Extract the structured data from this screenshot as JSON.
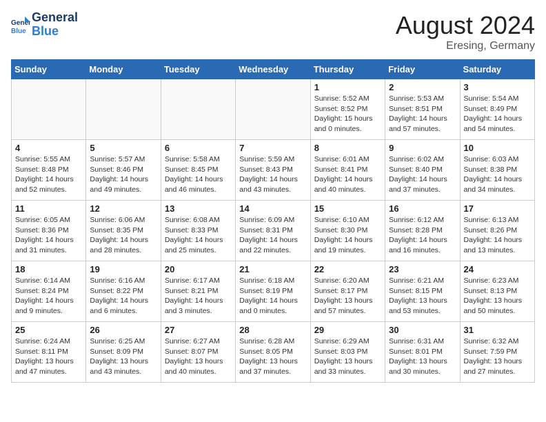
{
  "header": {
    "logo_line1": "General",
    "logo_line2": "Blue",
    "month_year": "August 2024",
    "location": "Eresing, Germany"
  },
  "weekdays": [
    "Sunday",
    "Monday",
    "Tuesday",
    "Wednesday",
    "Thursday",
    "Friday",
    "Saturday"
  ],
  "weeks": [
    [
      {
        "day": "",
        "info": ""
      },
      {
        "day": "",
        "info": ""
      },
      {
        "day": "",
        "info": ""
      },
      {
        "day": "",
        "info": ""
      },
      {
        "day": "1",
        "info": "Sunrise: 5:52 AM\nSunset: 8:52 PM\nDaylight: 15 hours\nand 0 minutes."
      },
      {
        "day": "2",
        "info": "Sunrise: 5:53 AM\nSunset: 8:51 PM\nDaylight: 14 hours\nand 57 minutes."
      },
      {
        "day": "3",
        "info": "Sunrise: 5:54 AM\nSunset: 8:49 PM\nDaylight: 14 hours\nand 54 minutes."
      }
    ],
    [
      {
        "day": "4",
        "info": "Sunrise: 5:55 AM\nSunset: 8:48 PM\nDaylight: 14 hours\nand 52 minutes."
      },
      {
        "day": "5",
        "info": "Sunrise: 5:57 AM\nSunset: 8:46 PM\nDaylight: 14 hours\nand 49 minutes."
      },
      {
        "day": "6",
        "info": "Sunrise: 5:58 AM\nSunset: 8:45 PM\nDaylight: 14 hours\nand 46 minutes."
      },
      {
        "day": "7",
        "info": "Sunrise: 5:59 AM\nSunset: 8:43 PM\nDaylight: 14 hours\nand 43 minutes."
      },
      {
        "day": "8",
        "info": "Sunrise: 6:01 AM\nSunset: 8:41 PM\nDaylight: 14 hours\nand 40 minutes."
      },
      {
        "day": "9",
        "info": "Sunrise: 6:02 AM\nSunset: 8:40 PM\nDaylight: 14 hours\nand 37 minutes."
      },
      {
        "day": "10",
        "info": "Sunrise: 6:03 AM\nSunset: 8:38 PM\nDaylight: 14 hours\nand 34 minutes."
      }
    ],
    [
      {
        "day": "11",
        "info": "Sunrise: 6:05 AM\nSunset: 8:36 PM\nDaylight: 14 hours\nand 31 minutes."
      },
      {
        "day": "12",
        "info": "Sunrise: 6:06 AM\nSunset: 8:35 PM\nDaylight: 14 hours\nand 28 minutes."
      },
      {
        "day": "13",
        "info": "Sunrise: 6:08 AM\nSunset: 8:33 PM\nDaylight: 14 hours\nand 25 minutes."
      },
      {
        "day": "14",
        "info": "Sunrise: 6:09 AM\nSunset: 8:31 PM\nDaylight: 14 hours\nand 22 minutes."
      },
      {
        "day": "15",
        "info": "Sunrise: 6:10 AM\nSunset: 8:30 PM\nDaylight: 14 hours\nand 19 minutes."
      },
      {
        "day": "16",
        "info": "Sunrise: 6:12 AM\nSunset: 8:28 PM\nDaylight: 14 hours\nand 16 minutes."
      },
      {
        "day": "17",
        "info": "Sunrise: 6:13 AM\nSunset: 8:26 PM\nDaylight: 14 hours\nand 13 minutes."
      }
    ],
    [
      {
        "day": "18",
        "info": "Sunrise: 6:14 AM\nSunset: 8:24 PM\nDaylight: 14 hours\nand 9 minutes."
      },
      {
        "day": "19",
        "info": "Sunrise: 6:16 AM\nSunset: 8:22 PM\nDaylight: 14 hours\nand 6 minutes."
      },
      {
        "day": "20",
        "info": "Sunrise: 6:17 AM\nSunset: 8:21 PM\nDaylight: 14 hours\nand 3 minutes."
      },
      {
        "day": "21",
        "info": "Sunrise: 6:18 AM\nSunset: 8:19 PM\nDaylight: 14 hours\nand 0 minutes."
      },
      {
        "day": "22",
        "info": "Sunrise: 6:20 AM\nSunset: 8:17 PM\nDaylight: 13 hours\nand 57 minutes."
      },
      {
        "day": "23",
        "info": "Sunrise: 6:21 AM\nSunset: 8:15 PM\nDaylight: 13 hours\nand 53 minutes."
      },
      {
        "day": "24",
        "info": "Sunrise: 6:23 AM\nSunset: 8:13 PM\nDaylight: 13 hours\nand 50 minutes."
      }
    ],
    [
      {
        "day": "25",
        "info": "Sunrise: 6:24 AM\nSunset: 8:11 PM\nDaylight: 13 hours\nand 47 minutes."
      },
      {
        "day": "26",
        "info": "Sunrise: 6:25 AM\nSunset: 8:09 PM\nDaylight: 13 hours\nand 43 minutes."
      },
      {
        "day": "27",
        "info": "Sunrise: 6:27 AM\nSunset: 8:07 PM\nDaylight: 13 hours\nand 40 minutes."
      },
      {
        "day": "28",
        "info": "Sunrise: 6:28 AM\nSunset: 8:05 PM\nDaylight: 13 hours\nand 37 minutes."
      },
      {
        "day": "29",
        "info": "Sunrise: 6:29 AM\nSunset: 8:03 PM\nDaylight: 13 hours\nand 33 minutes."
      },
      {
        "day": "30",
        "info": "Sunrise: 6:31 AM\nSunset: 8:01 PM\nDaylight: 13 hours\nand 30 minutes."
      },
      {
        "day": "31",
        "info": "Sunrise: 6:32 AM\nSunset: 7:59 PM\nDaylight: 13 hours\nand 27 minutes."
      }
    ]
  ]
}
